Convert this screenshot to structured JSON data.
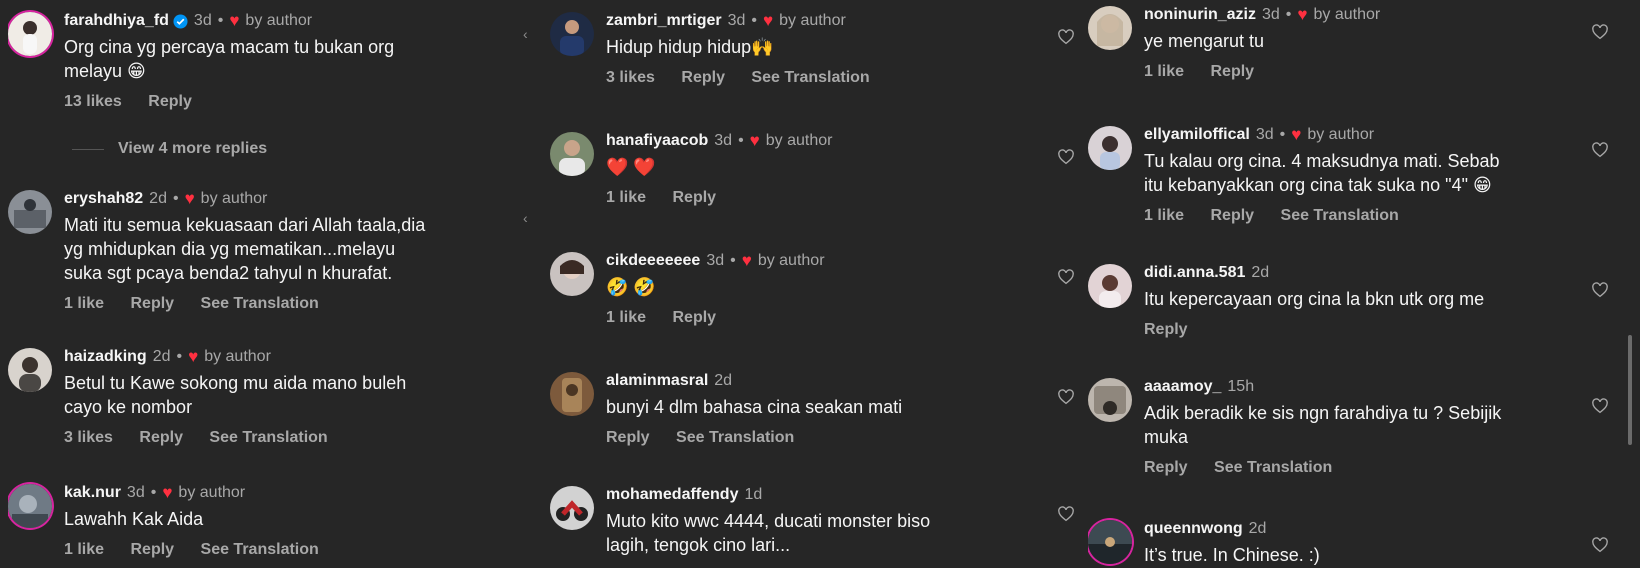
{
  "columns": [
    {
      "comments": [
        {
          "user": "farahdhiya_fd",
          "verified": true,
          "time": "3d",
          "liked_by": "by author",
          "lines": [
            "Org cina yg percaya macam tu bukan org",
            "melayu 😁"
          ],
          "actions": [
            "13 likes",
            "Reply"
          ],
          "avatar_color": "#f0ece6"
        },
        {
          "user": "eryshah82",
          "time": "2d",
          "liked_by": "by author",
          "lines": [
            "Mati itu semua kekuasaan dari Allah taala,dia",
            "yg mhidupkan dia yg mematikan...melayu",
            "suka sgt pcaya benda2 tahyul n khurafat."
          ],
          "actions": [
            "1 like",
            "Reply",
            "See Translation"
          ],
          "avatar_color": "#8a8f96"
        },
        {
          "user": "haizadking",
          "time": "2d",
          "liked_by": "by author",
          "lines": [
            "Betul tu Kawe sokong mu aida mano buleh",
            "cayo ke nombor"
          ],
          "actions": [
            "3 likes",
            "Reply",
            "See Translation"
          ],
          "avatar_color": "#b9b3ad"
        },
        {
          "user": "kak.nur",
          "time": "3d",
          "liked_by": "by author",
          "lines": [
            "Lawahh Kak Aida"
          ],
          "actions": [
            "1 like",
            "Reply",
            "See Translation"
          ],
          "avatar_color": "#6f7a85"
        }
      ],
      "view_replies": "View 4 more replies"
    },
    {
      "comments": [
        {
          "user": "zambri_mrtiger",
          "time": "3d",
          "liked_by": "by author",
          "lines": [
            "Hidup hidup hidup🙌"
          ],
          "actions": [
            "3 likes",
            "Reply",
            "See Translation"
          ],
          "avatar_color": "#2b3a5c"
        },
        {
          "user": "hanafiyaacob",
          "time": "3d",
          "liked_by": "by author",
          "lines": [
            "❤️ ❤️"
          ],
          "actions": [
            "1 like",
            "Reply"
          ],
          "avatar_color": "#7a8a6e"
        },
        {
          "user": "cikdeeeeeee",
          "time": "3d",
          "liked_by": "by author",
          "lines": [
            "🤣 🤣"
          ],
          "actions": [
            "1 like",
            "Reply"
          ],
          "avatar_color": "#c9c2c0"
        },
        {
          "user": "alaminmasral",
          "time": "2d",
          "lines": [
            "bunyi 4 dlm bahasa cina seakan mati"
          ],
          "actions": [
            "Reply",
            "See Translation"
          ],
          "avatar_color": "#7d5a3c"
        },
        {
          "user": "mohamedaffendy",
          "time": "1d",
          "lines": [
            "Muto kito wwc 4444, ducati monster biso",
            "lagih, tengok cino lari..."
          ],
          "actions": [],
          "avatar_color": "#c9c9c9"
        }
      ]
    },
    {
      "comments": [
        {
          "user": "noninurin_aziz",
          "time": "3d",
          "liked_by": "by author",
          "lines": [
            "ye mengarut tu"
          ],
          "actions": [
            "1 like",
            "Reply"
          ],
          "avatar_color": "#d8cdbf"
        },
        {
          "user": "ellyamiloffical",
          "time": "3d",
          "liked_by": "by author",
          "lines": [
            "Tu kalau org cina. 4 maksudnya mati. Sebab",
            "itu kebanyakkan org cina tak suka no \"4\" 😁"
          ],
          "actions": [
            "1 like",
            "Reply",
            "See Translation"
          ],
          "avatar_color": "#d9d2d6"
        },
        {
          "user": "didi.anna.581",
          "time": "2d",
          "lines": [
            "Itu kepercayaan org cina la bkn utk org me"
          ],
          "actions": [
            "Reply"
          ],
          "avatar_color": "#e2d3d5"
        },
        {
          "user": "aaaamoy_",
          "time": "15h",
          "lines": [
            "Adik beradik ke sis ngn farahdiya tu ? Sebijik",
            "muka"
          ],
          "actions": [
            "Reply",
            "See Translation"
          ],
          "avatar_color": "#bdb6ae"
        },
        {
          "user": "queennwong",
          "time": "2d",
          "lines": [
            "It’s true. In Chinese. :)"
          ],
          "actions": [],
          "avatar_color": "#3d4a52"
        }
      ]
    }
  ],
  "icons": {
    "like": "heart-outline-icon",
    "liked": "heart-filled-icon",
    "verified": "verified-badge-icon",
    "collapse": "chevron-left-icon"
  }
}
